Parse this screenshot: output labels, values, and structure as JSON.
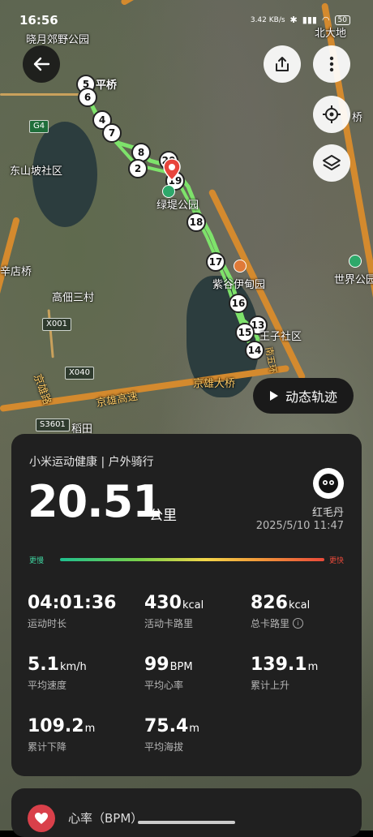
{
  "status_bar": {
    "time": "16:56",
    "network_speed": "3.42 KB/s",
    "battery": "50",
    "icons": [
      "bluetooth-icon",
      "signal-icon",
      "wifi-icon",
      "battery-icon"
    ]
  },
  "map": {
    "labels": {
      "park_top": "晓月郊野公园",
      "bridge": "平桥",
      "community": "东山坡社区",
      "xindian_bridge": "辛店桥",
      "village": "高佃三村",
      "lvdi_park": "绿堤公园",
      "ziji_park": "紫谷伊甸园",
      "xiaoqu": "北大地",
      "world_park": "世界公园",
      "wangzi": "王子社区",
      "jingxiong_bridge": "京雄大桥",
      "jingxiong_highway": "京雄高速",
      "jingxiong_road": "京雄路",
      "daotian": "稻田",
      "east_bridge": "桥",
      "south": "南五环"
    },
    "shields": [
      "G4",
      "X001",
      "X040",
      "S3601"
    ],
    "waypoints": [
      "5",
      "6",
      "4",
      "7",
      "8",
      "2",
      "20",
      "19",
      "18",
      "17",
      "16",
      "13",
      "15",
      "14"
    ],
    "track_color": "#7ee36b"
  },
  "buttons": {
    "back": "back-arrow-icon",
    "share": "share-icon",
    "more": "more-icon",
    "locate": "locate-icon",
    "layers": "layers-icon",
    "dynamic_track": "动态轨迹"
  },
  "summary": {
    "source": "小米运动健康 | 户外骑行",
    "distance": "20.51",
    "distance_unit": "公里",
    "user": "红毛丹",
    "datetime": "2025/5/10 11:47",
    "slow_label": "更慢",
    "fast_label": "更快"
  },
  "stats": [
    {
      "value": "04:01:36",
      "unit": "",
      "label": "运动时长"
    },
    {
      "value": "430",
      "unit": "kcal",
      "label": "活动卡路里"
    },
    {
      "value": "826",
      "unit": "kcal",
      "label": "总卡路里"
    },
    {
      "value": "5.1",
      "unit": "km/h",
      "label": "平均速度"
    },
    {
      "value": "99",
      "unit": "BPM",
      "label": "平均心率"
    },
    {
      "value": "139.1",
      "unit": "m",
      "label": "累计上升"
    },
    {
      "value": "109.2",
      "unit": "m",
      "label": "累计下降"
    },
    {
      "value": "75.4",
      "unit": "m",
      "label": "平均海拔"
    }
  ],
  "next_section": {
    "label": "心率（BPM）"
  },
  "colors": {
    "accent_red": "#d9404a",
    "panel_bg": "#202020"
  }
}
